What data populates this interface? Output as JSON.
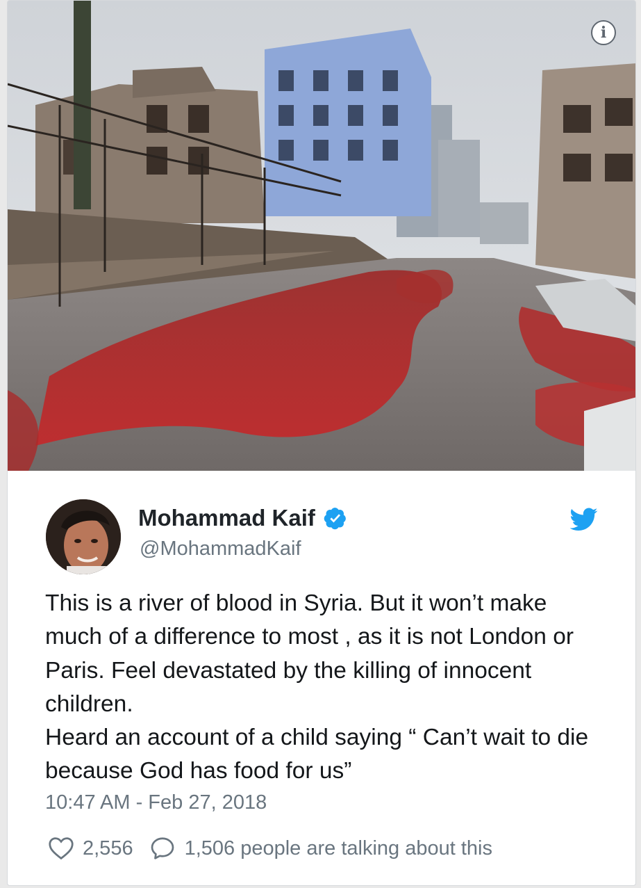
{
  "tweet": {
    "author_name": "Mohammad Kaif",
    "handle": "@MohammadKaif",
    "text_lines": [
      "This is a river of blood in Syria. But it won’t make much of a difference to most , as it is not London or Paris. Feel devastated by the killing of innocent children.",
      "Heard an account of a child saying “ Can’t wait to die because God has food for us”"
    ],
    "timestamp": "10:47 AM - Feb 27, 2018",
    "likes": "2,556",
    "talking": "1,506 people are talking about this"
  },
  "icons": {
    "info": "info-icon",
    "verified": "verified-badge-icon",
    "brand": "twitter-bird-icon",
    "like": "heart-icon",
    "reply": "speech-bubble-icon"
  },
  "colors": {
    "twitter_blue": "#1da1f2",
    "text": "#14171a",
    "muted": "#69757f"
  }
}
